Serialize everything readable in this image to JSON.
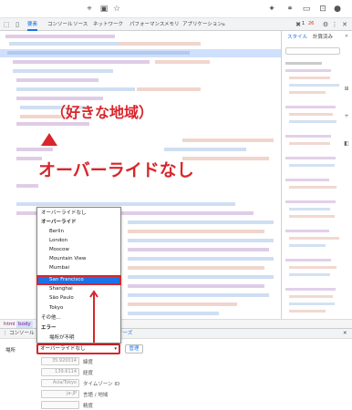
{
  "devtools": {
    "tabs": [
      {
        "label": "要素"
      },
      {
        "label": "コンソール"
      },
      {
        "label": "ソース"
      },
      {
        "label": "ネットワーク"
      },
      {
        "label": "パフォーマンス"
      },
      {
        "label": "メモリ"
      },
      {
        "label": "アプリケーション"
      }
    ],
    "side_tabs": {
      "styles": "スタイル",
      "computed": "計算済み"
    },
    "issue_count": "26",
    "error_count": "1"
  },
  "breadcrumb": {
    "html": "html",
    "body": "body"
  },
  "drawer_tabs": {
    "console": "コンソール",
    "sensors": "センサーズ"
  },
  "sensors": {
    "location_label": "場所",
    "selected_location": "オーバーライドなし",
    "manage_label": "管理",
    "fields": [
      {
        "value": "35.920014",
        "label": "緯度"
      },
      {
        "value": "139.6114",
        "label": "経度"
      },
      {
        "value": "Asia/Tokyo",
        "label": "タイムゾーン ID"
      },
      {
        "value": "ja-JP",
        "label": "言語 / 地域"
      },
      {
        "value": "",
        "label": "精度"
      }
    ]
  },
  "dropdown": {
    "no_override": "オーバーライドなし",
    "override_group": "オーバーライド",
    "cities": [
      "Berlin",
      "London",
      "Moscow",
      "Mountain View",
      "Mumbai",
      "San Francisco",
      "Shanghai",
      "São Paulo",
      "Tokyo"
    ],
    "other": "その他...",
    "error_group": "エラー",
    "unavailable": "場所が不明"
  },
  "annotations": {
    "region": "（好きな地域）",
    "override": "オーバーライドなし"
  },
  "colors": {
    "accent": "#1a73e8",
    "annotation_red": "#d8262b",
    "selection_blue": "#cfe0fc"
  }
}
